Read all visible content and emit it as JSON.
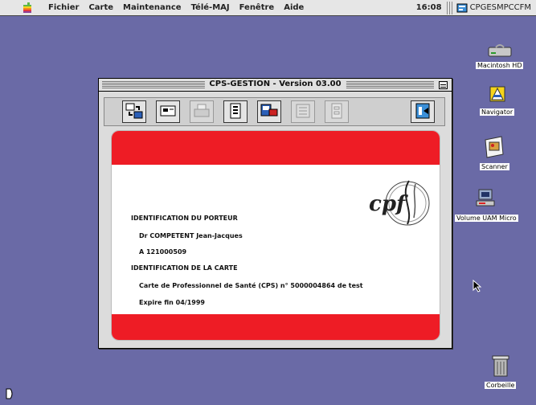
{
  "menubar": {
    "items": [
      "Fichier",
      "Carte",
      "Maintenance",
      "Télé-MAJ",
      "Fenêtre",
      "Aide"
    ],
    "clock": "16:08",
    "app_name": "CPGESMPCCFM"
  },
  "desktop": {
    "icons": [
      {
        "label": "Macintosh HD",
        "icon": "hard-drive-icon"
      },
      {
        "label": "Navigator",
        "icon": "navigator-icon"
      },
      {
        "label": "Scanner",
        "icon": "scanner-icon"
      },
      {
        "label": "Volume UAM Micro",
        "icon": "network-volume-icon"
      },
      {
        "label": "Corbeille",
        "icon": "trash-icon"
      }
    ]
  },
  "window": {
    "title": "CPS-GESTION - Version 03.00",
    "toolbar": [
      {
        "icon": "read-card-icon",
        "enabled": true
      },
      {
        "icon": "card-icon",
        "enabled": true
      },
      {
        "icon": "print-icon",
        "enabled": false
      },
      {
        "icon": "document-icon",
        "enabled": true
      },
      {
        "icon": "card-terminal-icon",
        "enabled": true
      },
      {
        "icon": "list-icon",
        "enabled": false
      },
      {
        "icon": "form-icon",
        "enabled": false
      },
      {
        "icon": "exit-icon",
        "enabled": true
      }
    ],
    "card": {
      "logo": "cpf",
      "holder_heading": "IDENTIFICATION DU PORTEUR",
      "holder_name": "Dr COMPETENT Jean-Jacques",
      "holder_id": "A 121000509",
      "card_heading": "IDENTIFICATION DE LA CARTE",
      "card_type": "Carte de Professionnel de Santé (CPS) n° 5000004864 de test",
      "expiry": "Expire fin 04/1999"
    }
  },
  "colors": {
    "desktop": "#6a6aa6",
    "card_band": "#ee1c25",
    "window_bg": "#dcdcdc"
  }
}
